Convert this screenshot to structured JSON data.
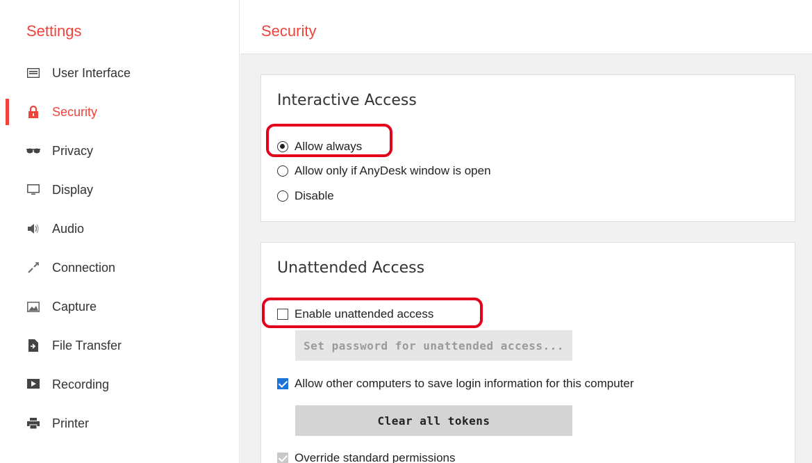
{
  "sidebar": {
    "title": "Settings",
    "items": [
      {
        "label": "User Interface",
        "icon": "user-interface-icon"
      },
      {
        "label": "Security",
        "icon": "lock-icon",
        "active": true
      },
      {
        "label": "Privacy",
        "icon": "sunglasses-icon"
      },
      {
        "label": "Display",
        "icon": "monitor-icon"
      },
      {
        "label": "Audio",
        "icon": "speaker-icon"
      },
      {
        "label": "Connection",
        "icon": "connection-icon"
      },
      {
        "label": "Capture",
        "icon": "picture-icon"
      },
      {
        "label": "File Transfer",
        "icon": "file-transfer-icon"
      },
      {
        "label": "Recording",
        "icon": "recording-icon"
      },
      {
        "label": "Printer",
        "icon": "printer-icon"
      }
    ]
  },
  "main": {
    "title": "Security",
    "interactive_access": {
      "title": "Interactive Access",
      "options": [
        {
          "label": "Allow always",
          "selected": true
        },
        {
          "label": "Allow only if AnyDesk window is open",
          "selected": false
        },
        {
          "label": "Disable",
          "selected": false
        }
      ]
    },
    "unattended_access": {
      "title": "Unattended Access",
      "enable_label": "Enable unattended access",
      "enable_checked": false,
      "set_password_label": "Set password for unattended access...",
      "allow_save_label": "Allow other computers to save login information for this computer",
      "allow_save_checked": true,
      "clear_tokens_label": "Clear all tokens",
      "override_label": "Override standard permissions",
      "override_checked": true
    }
  },
  "colors": {
    "accent": "#ef443b",
    "highlight": "#e3001b",
    "checkbox_blue": "#1a73d9"
  }
}
